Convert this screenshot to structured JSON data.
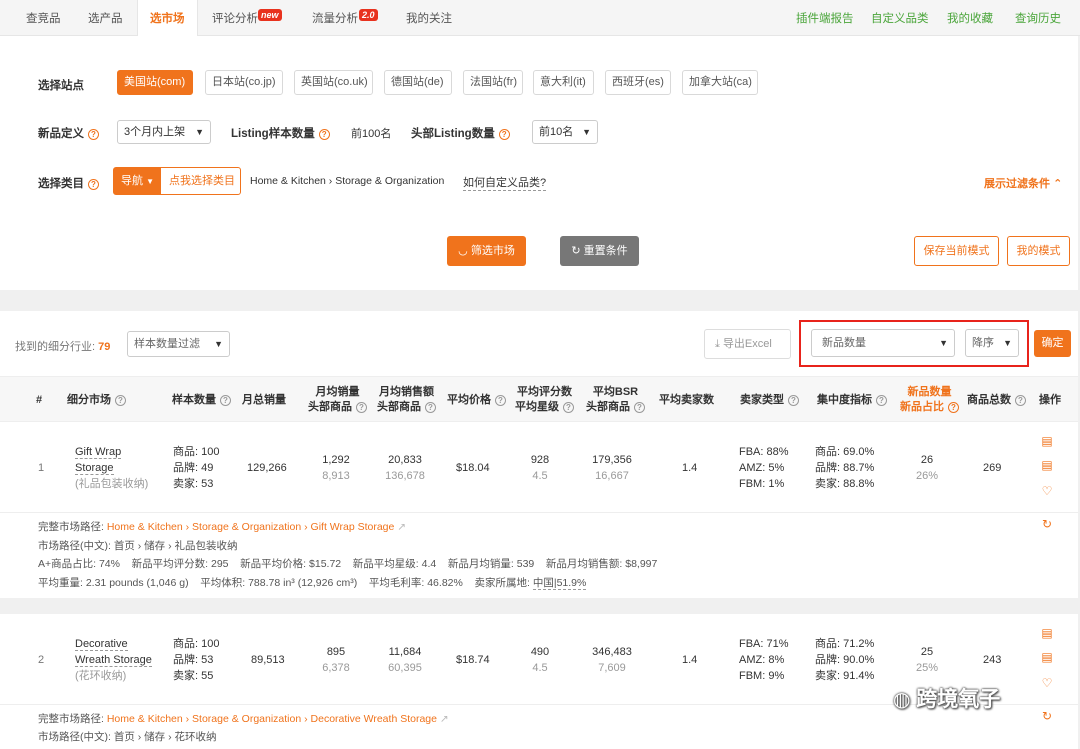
{
  "nav": {
    "tabs": [
      "查竞品",
      "选产品",
      "选市场",
      "评论分析",
      "流量分析",
      "我的关注"
    ],
    "active_tab": "选市场",
    "badges": {
      "review": "new",
      "traffic": "2.0"
    },
    "right_links": [
      "插件端报告",
      "自定义品类",
      "我的收藏",
      "查询历史"
    ]
  },
  "filters": {
    "site_label": "选择站点",
    "sites": [
      "美国站(com)",
      "日本站(co.jp)",
      "英国站(co.uk)",
      "德国站(de)",
      "法国站(fr)",
      "意大利(it)",
      "西班牙(es)",
      "加拿大站(ca)"
    ],
    "new_def_label": "新品定义",
    "new_def_value": "3个月内上架",
    "listing_sample_label": "Listing样本数量",
    "listing_sample_value": "前100名",
    "head_listing_label": "头部Listing数量",
    "head_listing_value": "前10名",
    "category_label": "选择类目",
    "nav_button": "导航",
    "pick_category": "点我选择类目",
    "breadcrumb": "Home & Kitchen › Storage & Organization",
    "custom_category_link": "如何自定义品类?",
    "expand_filters": "展示过滤条件",
    "filter_button": "筛选市场",
    "reset_button": "重置条件",
    "save_mode_button": "保存当前模式",
    "my_mode_button": "我的模式"
  },
  "results": {
    "found_label": "找到的细分行业:",
    "found_count": "79",
    "sample_filter_placeholder": "样本数量过滤",
    "export_button": "导出Excel",
    "sort_field": "新品数量",
    "sort_order": "降序",
    "confirm_button": "确定",
    "columns": {
      "num": "#",
      "market": "细分市场",
      "sample": "样本数量",
      "monthly_sales": "月总销量",
      "avg_sales_1": "月均销量",
      "avg_sales_2": "头部商品",
      "avg_revenue_1": "月均销售额",
      "avg_revenue_2": "头部商品",
      "avg_price": "平均价格",
      "avg_rating_1": "平均评分数",
      "avg_rating_2": "平均星级",
      "avg_bsr_1": "平均BSR",
      "avg_bsr_2": "头部商品",
      "avg_sellers": "平均卖家数",
      "seller_type": "卖家类型",
      "concentration": "集中度指标",
      "new_count_1": "新品数量",
      "new_count_2": "新品占比",
      "total_products": "商品总数",
      "actions": "操作"
    },
    "rows": [
      {
        "index": "1",
        "name_line1": "Gift Wrap",
        "name_line2": "Storage",
        "name_cn": "(礼品包装收纳)",
        "sample_goods": "商品: 100",
        "sample_brands": "品牌: 49",
        "sample_sellers": "卖家: 53",
        "monthly_sales": "129,266",
        "avg_sales": "1,292",
        "avg_sales_head": "8,913",
        "avg_revenue": "20,833",
        "avg_revenue_head": "136,678",
        "avg_price": "$18.04",
        "avg_reviews": "928",
        "avg_stars": "4.5",
        "avg_bsr": "179,356",
        "avg_bsr_head": "16,667",
        "avg_sellers": "1.4",
        "fba": "FBA: 88%",
        "amz": "AMZ: 5%",
        "fbm": "FBM: 1%",
        "conc_goods": "商品: 69.0%",
        "conc_brands": "品牌: 88.7%",
        "conc_sellers": "卖家: 88.8%",
        "new_count": "26",
        "new_ratio": "26%",
        "total": "269",
        "detail_path_label": "完整市场路径:",
        "detail_path": "Home & Kitchen › Storage & Organization › Gift Wrap Storage",
        "detail_cn_path": "市场路径(中文): 首页 › 储存 › 礼品包装收纳",
        "detail_line3": "A+商品占比: 74%    新品平均评分数: 295    新品平均价格: $15.72    新品平均星级: 4.4    新品月均销量: 539    新品月均销售额: $8,997",
        "detail_line4_a": "平均重量: 2.31 pounds (1,046 g)    平均体积: 788.78 in³ (12,926 cm³)    平均毛利率: 46.82%    卖家所属地:",
        "detail_line4_b": "中国|51.9%"
      },
      {
        "index": "2",
        "name_line1": "Decorative",
        "name_line2": "Wreath Storage",
        "name_cn": "(花环收纳)",
        "sample_goods": "商品: 100",
        "sample_brands": "品牌: 53",
        "sample_sellers": "卖家: 55",
        "monthly_sales": "89,513",
        "avg_sales": "895",
        "avg_sales_head": "6,378",
        "avg_revenue": "11,684",
        "avg_revenue_head": "60,395",
        "avg_price": "$18.74",
        "avg_reviews": "490",
        "avg_stars": "4.5",
        "avg_bsr": "346,483",
        "avg_bsr_head": "7,609",
        "avg_sellers": "1.4",
        "fba": "FBA: 71%",
        "amz": "AMZ: 8%",
        "fbm": "FBM: 9%",
        "conc_goods": "商品: 71.2%",
        "conc_brands": "品牌: 90.0%",
        "conc_sellers": "卖家: 91.4%",
        "new_count": "25",
        "new_ratio": "25%",
        "total": "243",
        "detail_path_label": "完整市场路径:",
        "detail_path": "Home & Kitchen › Storage & Organization › Decorative Wreath Storage",
        "detail_cn_path": "市场路径(中文): 首页 › 储存 › 花环收纳"
      }
    ]
  },
  "watermark": "跨境氧子",
  "colors": {
    "accent": "#f0731c",
    "green_link": "#4aa53a",
    "highlight_border": "#e8231b"
  }
}
